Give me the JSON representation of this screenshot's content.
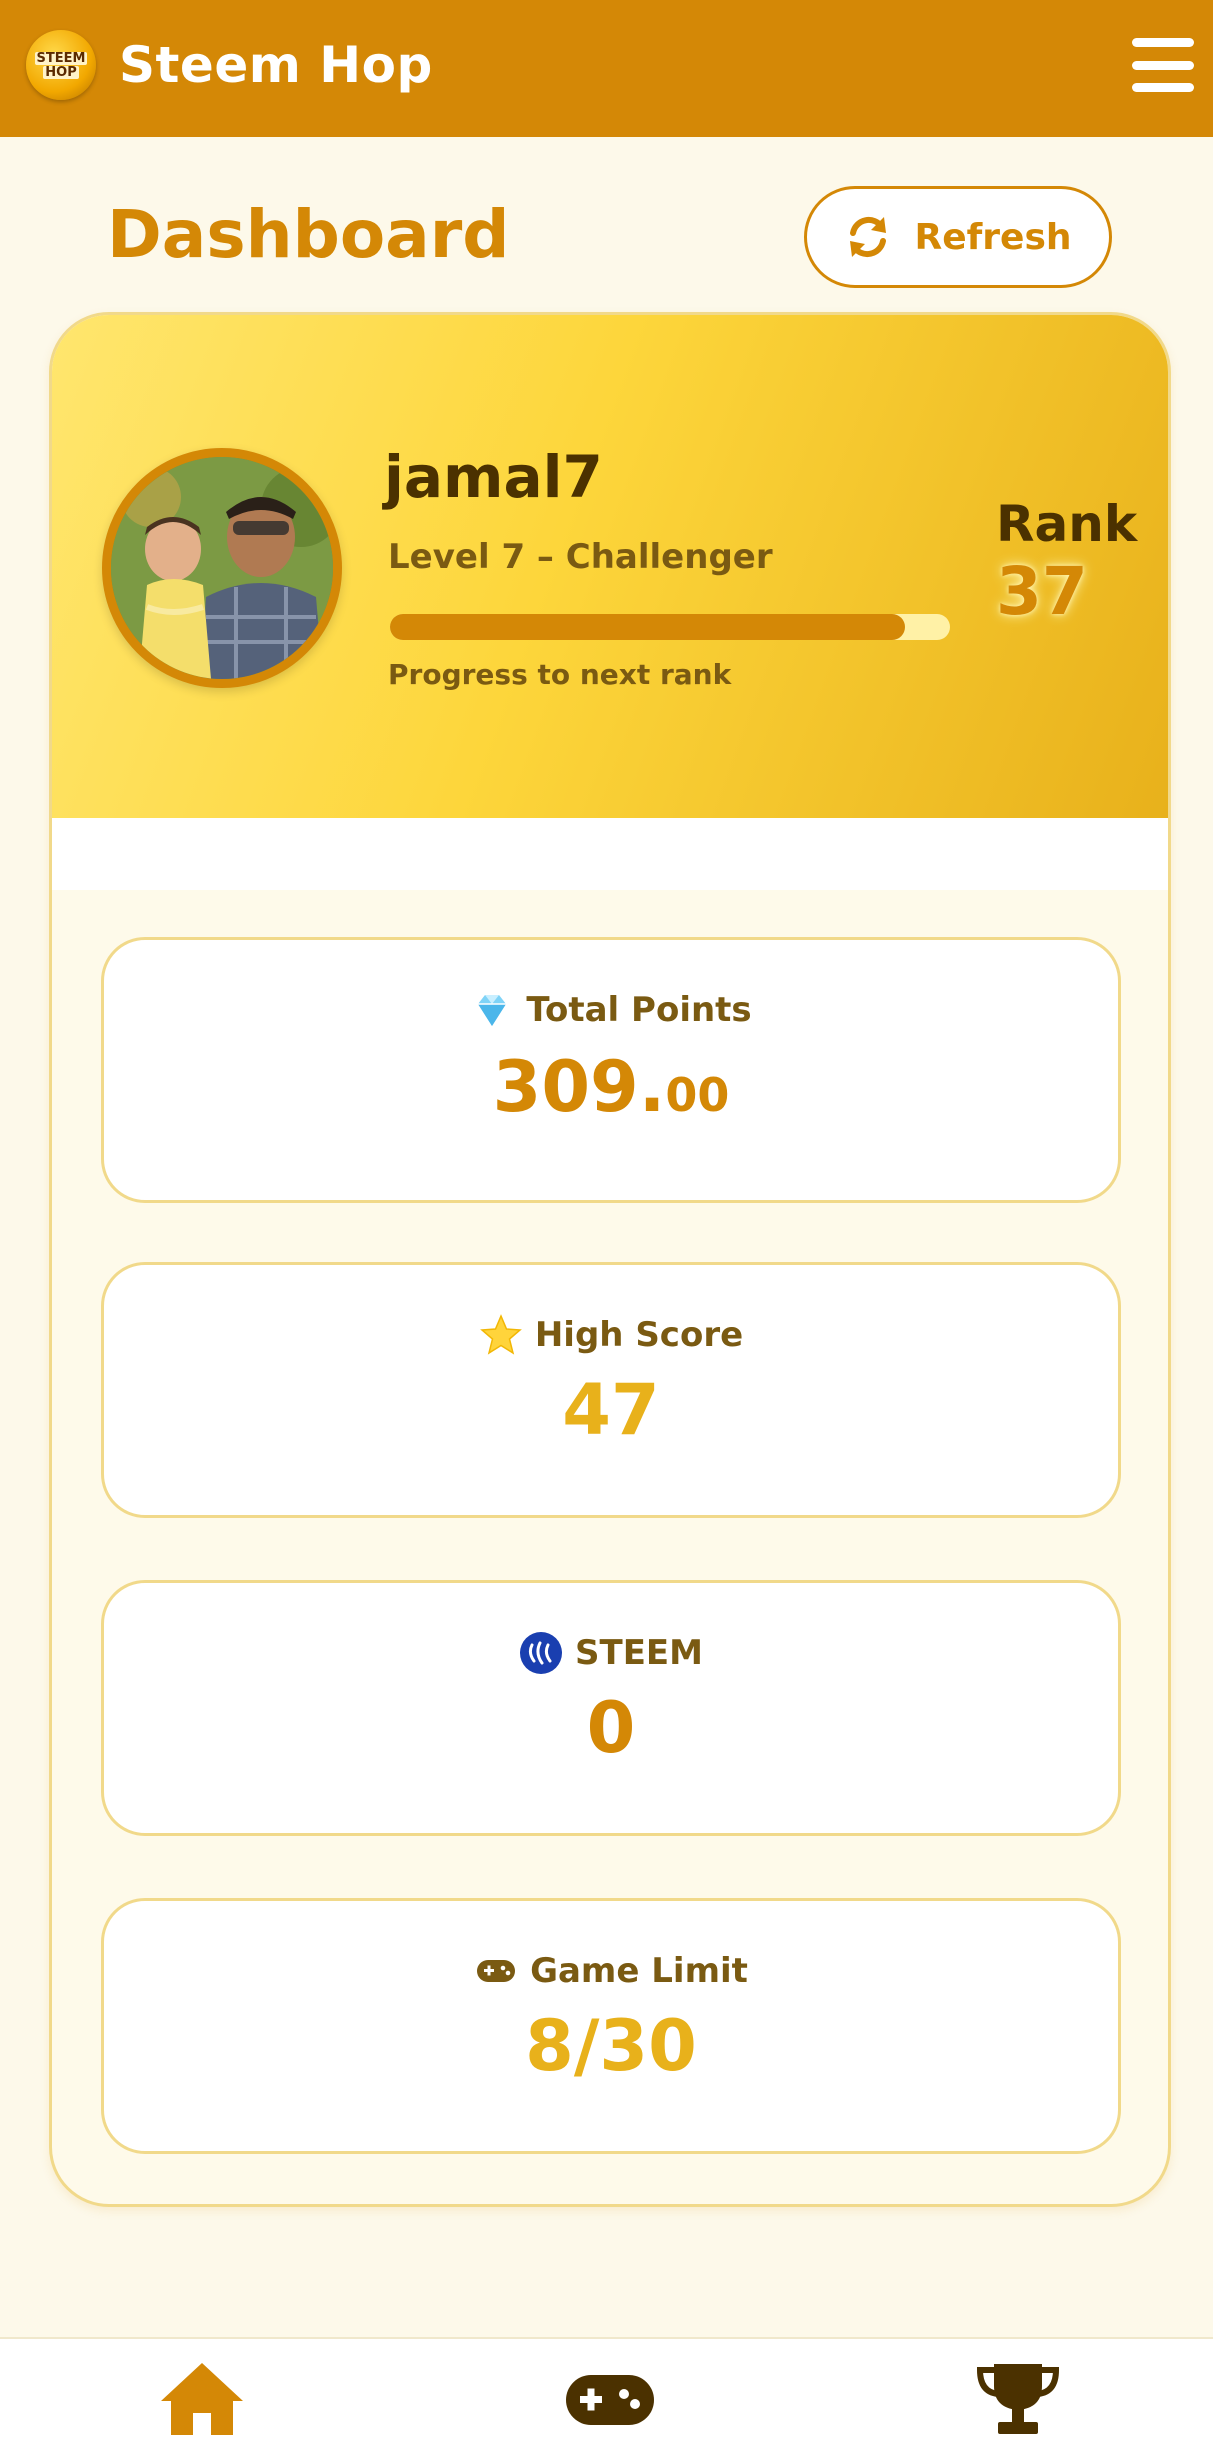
{
  "header": {
    "logo_line1": "STEEM",
    "logo_line2": "HOP",
    "app_title": "Steem Hop",
    "menu_icon": "hamburger-menu-icon"
  },
  "page": {
    "title": "Dashboard",
    "refresh_label": "Refresh",
    "refresh_icon": "refresh-icon"
  },
  "profile": {
    "username": "jamal7",
    "level_text": "Level 7 – Challenger",
    "progress_fraction": 0.92,
    "progress_label": "Progress to next rank",
    "rank_label": "Rank",
    "rank_value": "37"
  },
  "stats": {
    "points": {
      "icon": "diamond-icon",
      "label": "Total Points",
      "value_int": "309.",
      "value_dec": "00"
    },
    "high_score": {
      "icon": "star-icon",
      "label": "High Score",
      "value": "47"
    },
    "steem": {
      "icon": "steem-icon",
      "label": "STEEM",
      "value": "0"
    },
    "game_limit": {
      "icon": "gamepad-icon",
      "label": "Game Limit",
      "value": "8/30"
    }
  },
  "bottom_nav": {
    "items": [
      {
        "icon": "home-icon",
        "active": true
      },
      {
        "icon": "gamepad-icon",
        "active": false
      },
      {
        "icon": "trophy-icon",
        "active": false
      }
    ]
  },
  "colors": {
    "primary": "#d48806",
    "dark_text": "#4b3100",
    "gold": "#e8b11b",
    "background": "#fdf9ea"
  }
}
